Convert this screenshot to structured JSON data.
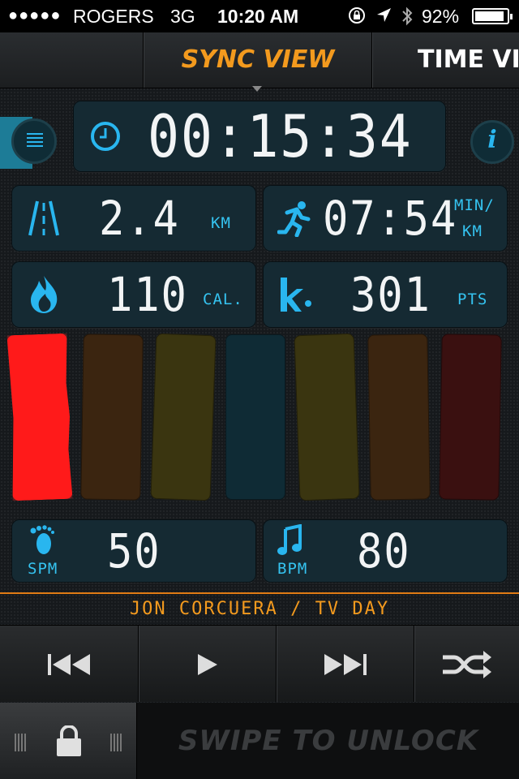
{
  "status_bar": {
    "signal": "●●●●●",
    "carrier": "ROGERS",
    "network": "3G",
    "time": "10:20 AM",
    "battery": "92%",
    "battery_level": 0.92
  },
  "tabs": {
    "active": "SYNC VIEW",
    "next": "TIME VI"
  },
  "timer": {
    "value": "00:15:34"
  },
  "stats": {
    "distance": {
      "value": "2.4",
      "unit": "KM"
    },
    "pace": {
      "value": "07:54",
      "unit_top": "MIN/",
      "unit_bottom": "KM"
    },
    "calories": {
      "value": "110",
      "unit": "CAL."
    },
    "points": {
      "value": "301",
      "unit": "PTS"
    }
  },
  "tempo_bars": [
    {
      "name": "bar-1",
      "color": "#ff1a1a",
      "active": true
    },
    {
      "name": "bar-2",
      "color": "#3b2510",
      "active": false
    },
    {
      "name": "bar-3",
      "color": "#3a3510",
      "active": false
    },
    {
      "name": "bar-4",
      "color": "#0f2b35",
      "active": false
    },
    {
      "name": "bar-5",
      "color": "#3a3510",
      "active": false
    },
    {
      "name": "bar-6",
      "color": "#3b2510",
      "active": false
    },
    {
      "name": "bar-7",
      "color": "#3a1010",
      "active": false
    }
  ],
  "cadence": {
    "spm": {
      "value": "50",
      "label": "SPM"
    },
    "bpm": {
      "value": "80",
      "label": "BPM"
    }
  },
  "now_playing": {
    "title": "JON CORCUERA / TV DAY"
  },
  "unlock": {
    "label": "SWIPE TO UNLOCK"
  },
  "colors": {
    "accent": "#f39a1e",
    "cyan": "#29b6ef",
    "panel": "#152a33"
  }
}
